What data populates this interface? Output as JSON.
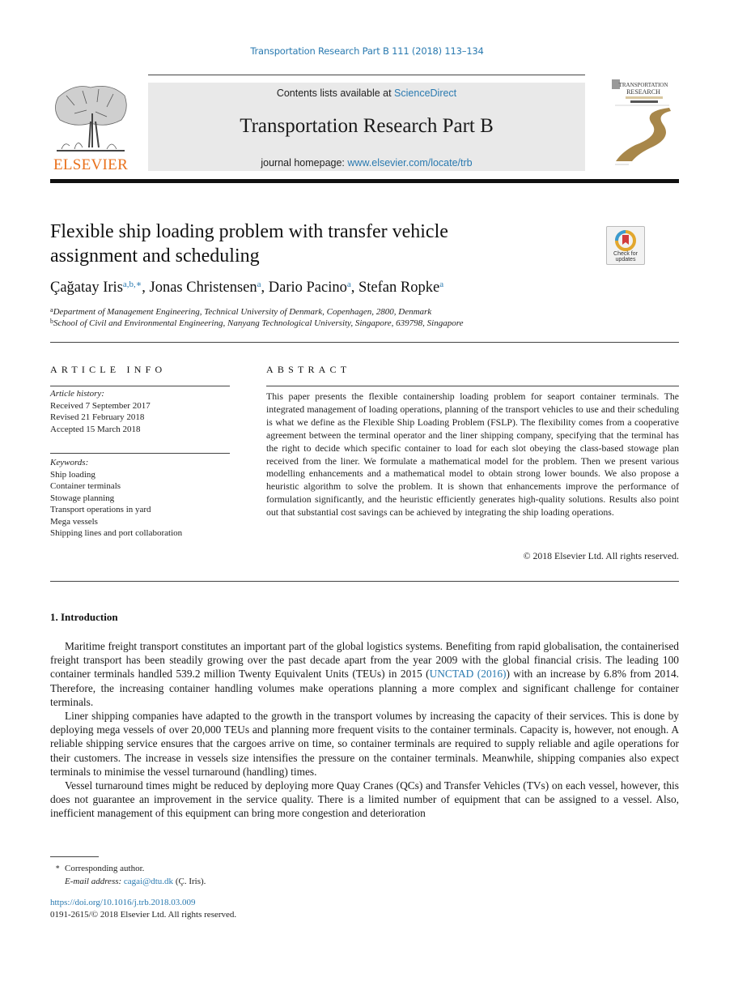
{
  "running_head": "Transportation Research Part B 111 (2018) 113–134",
  "header": {
    "contents_prefix": "Contents lists available at ",
    "contents_link": "ScienceDirect",
    "journal_title": "Transportation Research Part B",
    "homepage_prefix": "journal homepage: ",
    "homepage_link": "www.elsevier.com/locate/trb"
  },
  "publisher_logo": {
    "wordmark": "ELSEVIER",
    "icon": "elsevier-tree-icon",
    "color": "#e9711c"
  },
  "journal_cover": {
    "icon": "journal-cover-icon",
    "title_lines": [
      "TRANSPORTATION",
      "RESEARCH"
    ],
    "accent": "#a8874a"
  },
  "crossmark": {
    "icon": "check-for-updates-icon",
    "line1": "Check for",
    "line2": "updates"
  },
  "article": {
    "title_line1": "Flexible ship loading problem with transfer vehicle",
    "title_line2": "assignment and scheduling",
    "authors": [
      {
        "name": "Çağatay Iris",
        "marks": "a,b,∗",
        "sep": ", "
      },
      {
        "name": "Jonas Christensen",
        "marks": "a",
        "sep": ", "
      },
      {
        "name": "Dario Pacino",
        "marks": "a",
        "sep": ", "
      },
      {
        "name": "Stefan Ropke",
        "marks": "a",
        "sep": ""
      }
    ],
    "affiliations": [
      {
        "mark": "a",
        "text": "Department of Management Engineering, Technical University of Denmark, Copenhagen, 2800, Denmark"
      },
      {
        "mark": "b",
        "text": "School of Civil and Environmental Engineering, Nanyang Technological University, Singapore, 639798, Singapore"
      }
    ]
  },
  "article_info": {
    "heading": "ARTICLE INFO",
    "history_label": "Article history:",
    "history": [
      "Received 7 September 2017",
      "Revised 21 February 2018",
      "Accepted 15 March 2018"
    ],
    "keywords_label": "Keywords:",
    "keywords": [
      "Ship loading",
      "Container terminals",
      "Stowage planning",
      "Transport operations in yard",
      "Mega vessels",
      "Shipping lines and port collaboration"
    ]
  },
  "abstract": {
    "heading": "ABSTRACT",
    "text": "This paper presents the flexible containership loading problem for seaport container terminals. The integrated management of loading operations, planning of the transport vehicles to use and their scheduling is what we define as the Flexible Ship Loading Problem (FSLP). The flexibility comes from a cooperative agreement between the terminal operator and the liner shipping company, specifying that the terminal has the right to decide which specific container to load for each slot obeying the class-based stowage plan received from the liner. We formulate a mathematical model for the problem. Then we present various modelling enhancements and a mathematical model to obtain strong lower bounds. We also propose a heuristic algorithm to solve the problem. It is shown that enhancements improve the performance of formulation significantly, and the heuristic efficiently generates high-quality solutions. Results also point out that substantial cost savings can be achieved by integrating the ship loading operations.",
    "copyright": "© 2018 Elsevier Ltd. All rights reserved."
  },
  "introduction": {
    "heading": "1. Introduction",
    "p1_before_link": "Maritime freight transport constitutes an important part of the global logistics systems. Benefiting from rapid globalisation, the containerised freight transport has been steadily growing over the past decade apart from the year 2009 with the global financial crisis. The leading 100 container terminals handled 539.2 million Twenty Equivalent Units (TEUs) in 2015 (",
    "p1_link": "UNCTAD (2016)",
    "p1_after_link": ") with an increase by 6.8% from 2014. Therefore, the increasing container handling volumes make operations planning a more complex and significant challenge for container terminals.",
    "p2": "Liner shipping companies have adapted to the growth in the transport volumes by increasing the capacity of their services. This is done by deploying mega vessels of over 20,000 TEUs and planning more frequent visits to the container terminals. Capacity is, however, not enough. A reliable shipping service ensures that the cargoes arrive on time, so container terminals are required to supply reliable and agile operations for their customers. The increase in vessels size intensifies the pressure on the container terminals. Meanwhile, shipping companies also expect terminals to minimise the vessel turnaround (handling) times.",
    "p3": "Vessel turnaround times might be reduced by deploying more Quay Cranes (QCs) and Transfer Vehicles (TVs) on each vessel, however, this does not guarantee an improvement in the service quality. There is a limited number of equipment that can be assigned to a vessel. Also, inefficient management of this equipment can bring more congestion and deterioration"
  },
  "footnote": {
    "star": "∗",
    "corresponding": "Corresponding author.",
    "email_label": "E-mail address: ",
    "email": "cagai@dtu.dk",
    "email_suffix": " (Ç. Iris)."
  },
  "doi": {
    "link": "https://doi.org/10.1016/j.trb.2018.03.009",
    "issn_line": "0191-2615/© 2018 Elsevier Ltd. All rights reserved."
  }
}
